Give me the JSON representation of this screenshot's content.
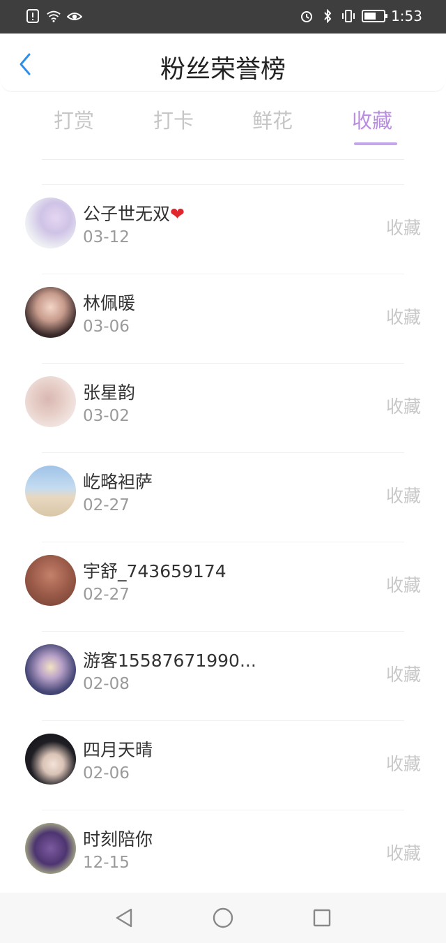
{
  "status_bar": {
    "time": "1:53",
    "battery_level": 0.6,
    "left_icons": [
      "warning-icon",
      "wifi-icon",
      "eye-icon"
    ],
    "right_icons": [
      "alarm-icon",
      "bluetooth-icon",
      "vibrate-icon",
      "battery-icon"
    ]
  },
  "header": {
    "title": "粉丝荣誉榜",
    "back_icon": "chevron-left-icon",
    "accent_color": "#2f8fe8"
  },
  "tabs": [
    {
      "label": "打赏",
      "active": false
    },
    {
      "label": "打卡",
      "active": false
    },
    {
      "label": "鲜花",
      "active": false
    },
    {
      "label": "收藏",
      "active": true
    }
  ],
  "colors": {
    "tab_active": "#b98ee0",
    "tab_inactive": "#c6c6c6",
    "action_text": "#c8c8c8",
    "heart": "#e0272e"
  },
  "list": [
    {
      "name": "公子世无双",
      "suffix": "❤",
      "date": "03-12",
      "action": "收藏"
    },
    {
      "name": "林佩暖",
      "date": "03-06",
      "action": "收藏"
    },
    {
      "name": "张星韵",
      "date": "03-02",
      "action": "收藏"
    },
    {
      "name": "屹略袒萨",
      "date": "02-27",
      "action": "收藏"
    },
    {
      "name": "宇舒_743659174",
      "date": "02-27",
      "action": "收藏"
    },
    {
      "name": "游客15587671990...",
      "date": "02-08",
      "action": "收藏"
    },
    {
      "name": "四月天晴",
      "date": "02-06",
      "action": "收藏"
    },
    {
      "name": "时刻陪你",
      "date": "12-15",
      "action": "收藏"
    }
  ],
  "nav_bar": {
    "buttons": [
      "back-triangle-icon",
      "home-circle-icon",
      "recents-square-icon"
    ]
  }
}
